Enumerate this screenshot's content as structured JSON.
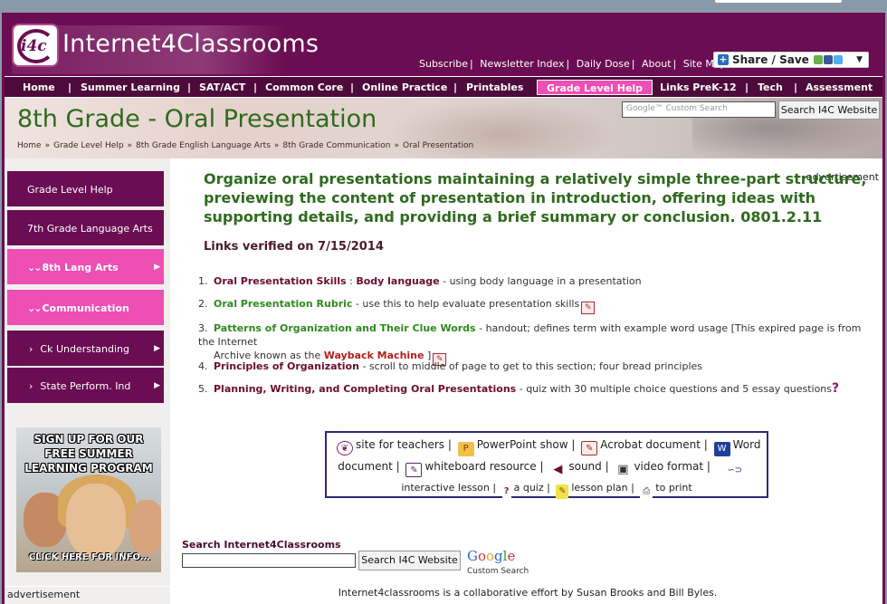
{
  "site": {
    "logo_text": "Internet4Classrooms",
    "logo_mark": "i4c"
  },
  "toplinks": [
    "Subscribe",
    "Newsletter Index",
    "Daily Dose",
    "About",
    "Site Map"
  ],
  "share": {
    "label": "Share / Save"
  },
  "nav": [
    "Home",
    "Summer Learning",
    "SAT/ACT",
    "Common Core",
    "Online Practice",
    "Printables",
    "Grade Level Help",
    "Links PreK-12",
    "Tech",
    "Assessment"
  ],
  "banner": {
    "title": "8th Grade - Oral Presentation",
    "search_placeholder": "Google™ Custom Search",
    "search_button": "Search I4C Website",
    "breadcrumb": [
      "Home",
      "Grade Level Help",
      "8th Grade English Language Arts",
      "8th Grade Communication",
      "Oral Presentation"
    ]
  },
  "sidebar": {
    "items": [
      {
        "label": "Grade Level Help"
      },
      {
        "label": "7th Grade Language Arts"
      },
      {
        "label": "8th Lang Arts"
      },
      {
        "label": "Communication"
      },
      {
        "label": "Ck Understanding"
      },
      {
        "label": "State Perform. Ind"
      }
    ],
    "promo": {
      "line1": "SIGN UP FOR OUR",
      "line2": "FREE SUMMER",
      "line3": "LEARNING PROGRAM",
      "cta": "CLICK HERE FOR INFO..."
    },
    "ad_label": "advertisement"
  },
  "main": {
    "ad_label": "advertisement",
    "standard": "Organize oral presentations maintaining a relatively simple three-part structure, previewing the content of presentation in introduction, offering ideas with supporting details, and providing a brief summary or conclusion. 0801.2.11",
    "verified": "Links verified on 7/15/2014",
    "links": [
      {
        "num": "1.",
        "title_a": "Oral Presentation Skills",
        "title_b": "Body language",
        "desc": " - using body language in a presentation"
      },
      {
        "num": "2.",
        "title": "Oral Presentation Rubric",
        "desc": " - use this to help evaluate presentation skills"
      },
      {
        "num": "3.",
        "title": "Patterns of Organization and Their Clue Words",
        "desc": " - handout; defines term with example word usage [This expired page is from the Internet",
        "desc2": "Archive known as the ",
        "wayback": "Wayback Machine",
        "desc3": " ]"
      },
      {
        "num": "4.",
        "title": "Principles of Organization",
        "desc": " - scroll to middle of page to get to this section; four bread principles"
      },
      {
        "num": "5.",
        "title": "Planning, Writing, and Completing Oral Presentations",
        "desc": " - quiz with 30 multiple choice questions and 5 essay questions"
      }
    ],
    "legend": {
      "teachers": "site for teachers",
      "ppt": "PowerPoint show",
      "acrobat": "Acrobat document",
      "word_a": "Word",
      "word_b": "document",
      "whiteboard": "whiteboard resource",
      "sound": "sound",
      "video": "video format",
      "interactive": "interactive lesson",
      "quiz": "a quiz",
      "lesson": "lesson plan",
      "print": "to print"
    },
    "search": {
      "label": "Search Internet4Classrooms",
      "button": "Search I4C Website",
      "google": "Google",
      "google_sub": "Custom Search"
    }
  },
  "footer": "Internet4classrooms is a collaborative effort by Susan Brooks and Bill Byles.",
  "colors": {
    "brand": "#6b0d52",
    "accent_pink": "#ee4fb4",
    "title_green": "#2e6b1e"
  }
}
